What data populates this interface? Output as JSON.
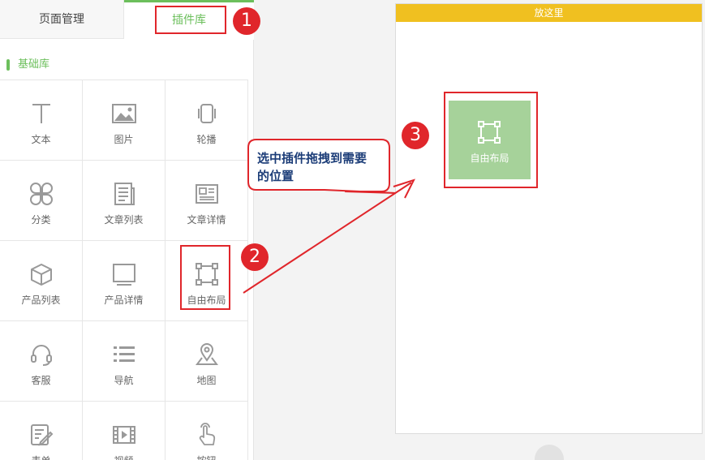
{
  "tabs": {
    "page_manage": "页面管理",
    "plugin_lib": "插件库"
  },
  "section": {
    "basic_lib": "基础库"
  },
  "plugins": [
    {
      "label": "文本",
      "icon": "text-icon"
    },
    {
      "label": "图片",
      "icon": "image-icon"
    },
    {
      "label": "轮播",
      "icon": "carousel-icon"
    },
    {
      "label": "分类",
      "icon": "category-icon"
    },
    {
      "label": "文章列表",
      "icon": "article-list-icon"
    },
    {
      "label": "文章详情",
      "icon": "article-detail-icon"
    },
    {
      "label": "产品列表",
      "icon": "product-list-icon"
    },
    {
      "label": "产品详情",
      "icon": "product-detail-icon"
    },
    {
      "label": "自由布局",
      "icon": "free-layout-icon"
    },
    {
      "label": "客服",
      "icon": "headset-icon"
    },
    {
      "label": "导航",
      "icon": "nav-list-icon"
    },
    {
      "label": "地图",
      "icon": "map-pin-icon"
    },
    {
      "label": "表单",
      "icon": "form-icon"
    },
    {
      "label": "视频",
      "icon": "video-icon"
    },
    {
      "label": "按钮",
      "icon": "tap-hand-icon"
    }
  ],
  "canvas": {
    "drop_here": "放这里",
    "dropped_label": "自由布局"
  },
  "annotations": {
    "step1": "1",
    "step2": "2",
    "step3": "3",
    "callout_line1": "选中插件拖拽到需要",
    "callout_line2": "的位置"
  },
  "colors": {
    "accent": "#6cbf5c",
    "canvas_header": "#f0c020",
    "annotation": "#e0262b",
    "dropped_bg": "#a6d29a",
    "callout_text": "#1c3d78"
  }
}
